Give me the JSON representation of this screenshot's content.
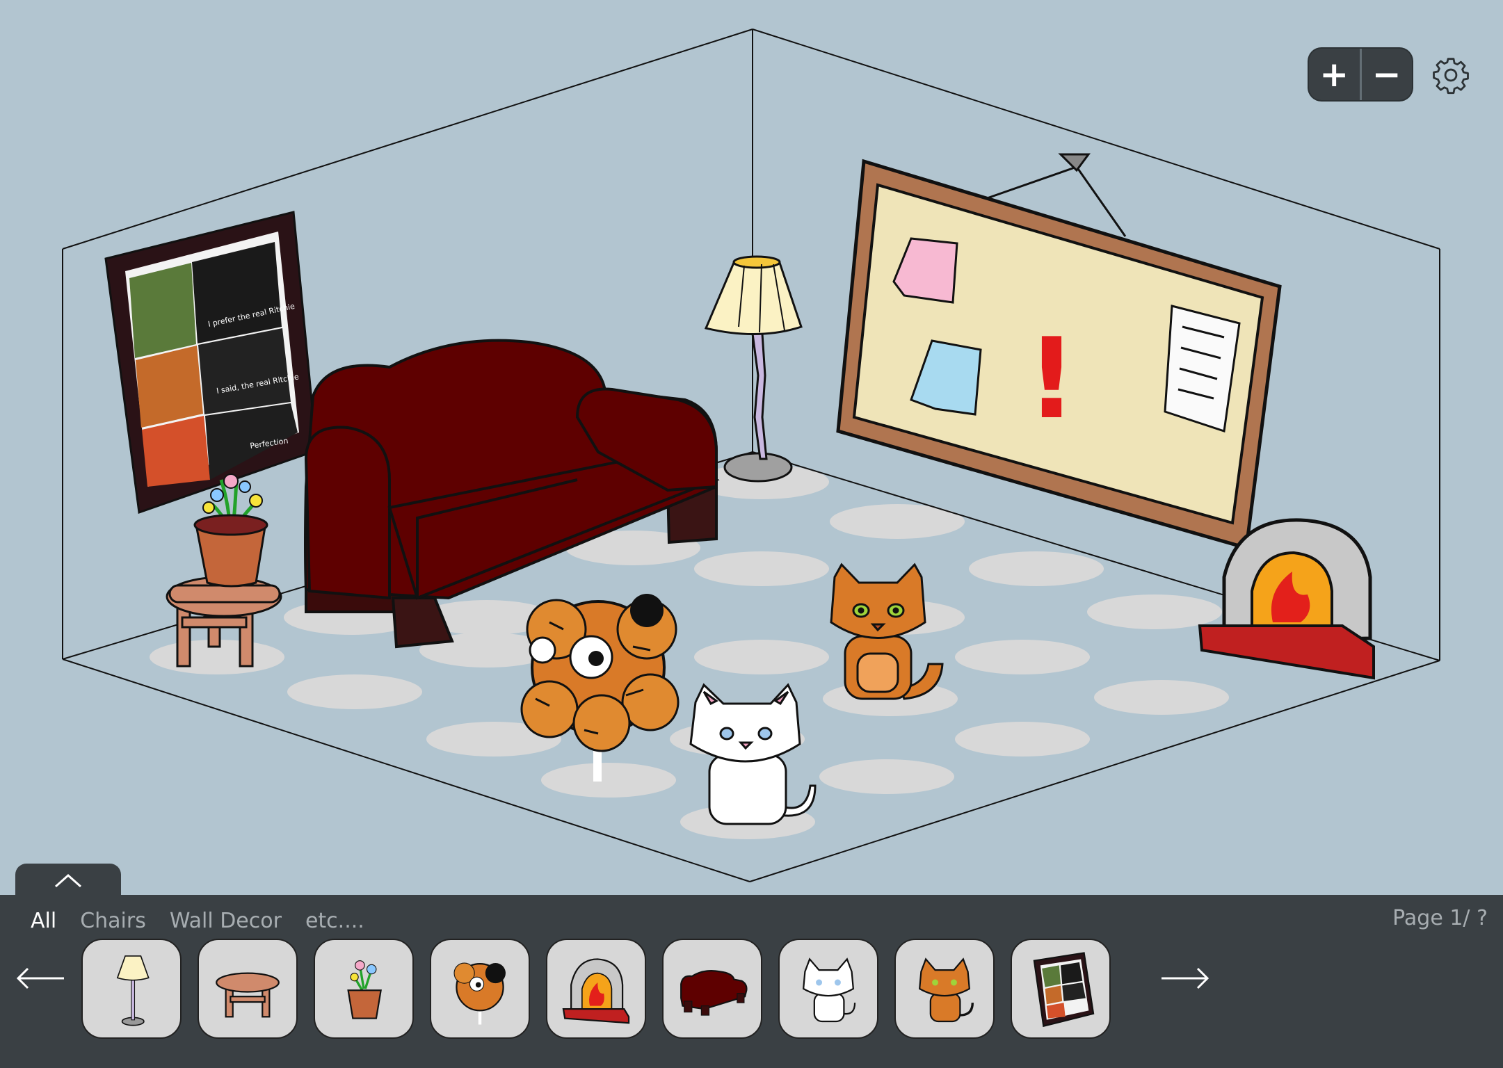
{
  "toolbar": {
    "zoom_in": "+",
    "zoom_out": "−"
  },
  "board": {
    "exclamation": "!"
  },
  "poster": {
    "captions": [
      "I prefer the real Ritchie",
      "I said, the real Ritchie",
      "Perfection"
    ]
  },
  "inventory": {
    "tabs": [
      "All",
      "Chairs",
      "Wall Decor",
      "etc...."
    ],
    "active_tab": "All",
    "page_indicator": "Page 1/ ?",
    "items": [
      "floor-lamp",
      "stool",
      "flower-pot",
      "tiger-plush",
      "fireplace",
      "couch",
      "white-cat",
      "orange-cat",
      "poster"
    ]
  },
  "colors": {
    "background": "#b2c5d0",
    "floor_spot": "#d8d8d8",
    "panel": "#3a4044",
    "couch": "#5e0000",
    "frame": "#b07550",
    "board": "#efe4b8",
    "exclamation": "#e31b1b"
  }
}
